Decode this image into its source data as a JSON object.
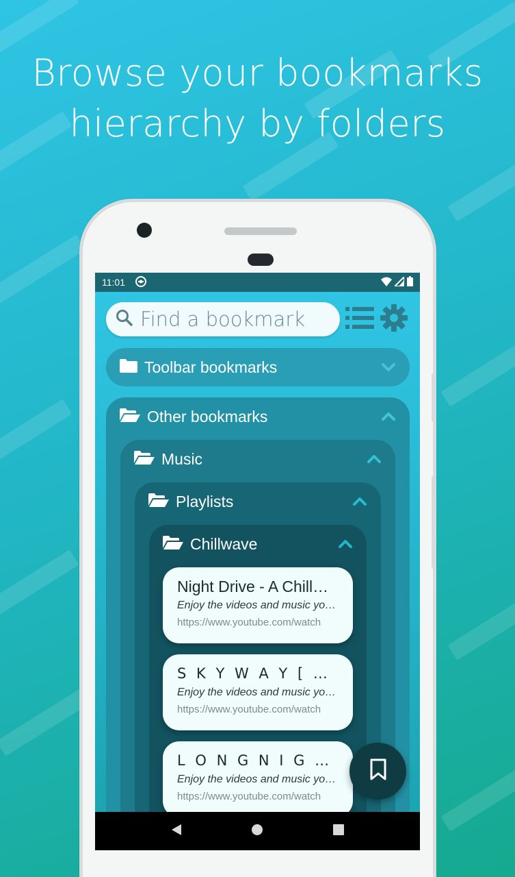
{
  "headline": {
    "line1": "Browse your bookmarks",
    "line2": "hierarchy by folders"
  },
  "status_bar": {
    "time": "11:01"
  },
  "search": {
    "placeholder": "Find a bookmark"
  },
  "icons": {
    "search": "search-icon",
    "list": "list-icon",
    "settings": "gear-icon",
    "folder_closed": "folder-icon",
    "folder_open": "folder-open-icon",
    "chevron_down": "chevron-down-icon",
    "chevron_up": "chevron-up-icon",
    "bookmark": "bookmark-icon"
  },
  "folders": {
    "toolbar": {
      "label": "Toolbar bookmarks",
      "expanded": false
    },
    "other": {
      "label": "Other bookmarks",
      "expanded": true
    },
    "music": {
      "label": "Music",
      "expanded": true
    },
    "playlists": {
      "label": "Playlists",
      "expanded": true
    },
    "chillwave": {
      "label": "Chillwave",
      "expanded": true
    }
  },
  "bookmarks": [
    {
      "title": "Night Drive - A Chillwave Mix",
      "description": "Enjoy the videos and music you love",
      "url": "https://www.youtube.com/watch"
    },
    {
      "title": "S K Y W A Y [ Chillwave ]",
      "description": "Enjoy the videos and music you love",
      "url": "https://www.youtube.com/watch"
    },
    {
      "title": "L O N G N I G H T",
      "description": "Enjoy the videos and music you love",
      "url": "https://www.youtube.com/watch"
    }
  ],
  "colors": {
    "accent_dark": "#0f3b43",
    "status_bar": "#1b6670",
    "card_bg": "#f1fcfd"
  }
}
